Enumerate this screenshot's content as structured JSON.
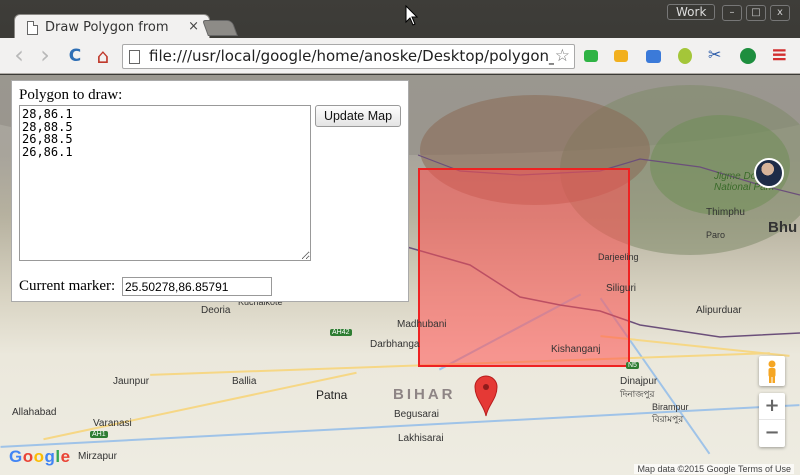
{
  "browser": {
    "tab_title": "Draw Polygon from",
    "tab_close": "×",
    "profile_label": "Work",
    "url": "file:///usr/local/google/home/anoske/Desktop/polygon_draw",
    "back_icon": "‹",
    "forward_icon": "›",
    "reload_icon": "C",
    "home_icon": "⌂",
    "star_icon": "☆",
    "menu_icon": "≡",
    "win_min": "–",
    "win_max": "□",
    "win_close": "x"
  },
  "panel": {
    "polygon_label": "Polygon to draw:",
    "polygon_text": "28,86.1\n28,88.5\n26,88.5\n26,86.1",
    "update_button": "Update Map",
    "marker_label": "Current marker:",
    "marker_value": "25.50278,86.85791"
  },
  "map": {
    "places": {
      "deoria": "Deoria",
      "kuchaikote": "Kuchaikote",
      "madhubani": "Madhubani",
      "darbhanga": "Darbhanga",
      "kishanganj": "Kishanganj",
      "siliguri": "Siliguri",
      "darjeeling": "Darjeeling",
      "thimphu": "Thimphu",
      "paro": "Paro",
      "bhu": "Bhu",
      "jigme_park": "Jigme Dorji\nNational Park",
      "alipurduar": "Alipurduar",
      "dinajpur": "Dinajpur",
      "dinajpur_bn": "দিনাজপুর",
      "birampur": "Birampur",
      "birampur_bn": "বিরামপুর",
      "jaunpur": "Jaunpur",
      "ballia": "Ballia",
      "patna": "Patna",
      "bihar": "BIHAR",
      "begusarai": "Begusarai",
      "allahabad": "Allahabad",
      "varanasi": "Varanasi",
      "lakhisarai": "Lakhisarai",
      "mirzapur": "Mirzapur"
    },
    "shields": [
      "AH42",
      "AH1",
      "N5"
    ],
    "zoom_in": "+",
    "zoom_out": "−",
    "google": [
      "G",
      "o",
      "o",
      "g",
      "l",
      "e"
    ],
    "attribution": "Map data ©2015 Google    Terms of Use"
  },
  "colors": {
    "polygon_fill": "#ff5050",
    "polygon_stroke": "#ee2222",
    "marker": "#e53935"
  }
}
